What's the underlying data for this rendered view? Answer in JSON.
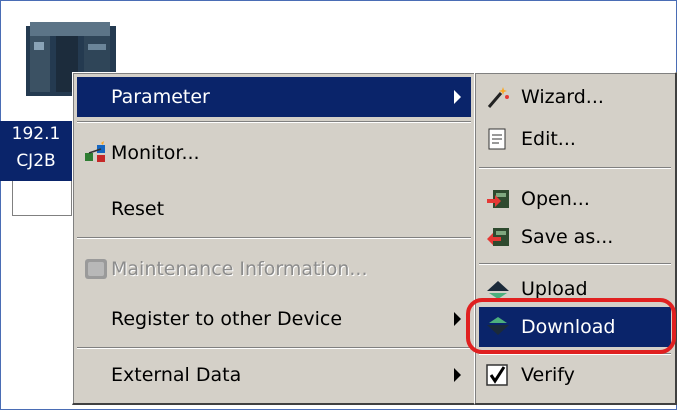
{
  "device": {
    "label_line1": "192.1",
    "label_line2": "CJ2B"
  },
  "context_menu": {
    "items": [
      {
        "label": "Parameter",
        "icon": "none",
        "has_submenu": true,
        "selected": true
      },
      {
        "label": "Monitor...",
        "icon": "monitor-icon",
        "has_submenu": false
      },
      {
        "label": "Reset",
        "icon": "none",
        "has_submenu": false
      },
      {
        "label": "Maintenance Information...",
        "icon": "maintenance-icon",
        "disabled": true
      },
      {
        "label": "Register to other Device",
        "icon": "none",
        "has_submenu": true
      },
      {
        "label": "External Data",
        "icon": "none",
        "has_submenu": true
      }
    ]
  },
  "parameter_submenu": {
    "items": [
      {
        "label": "Wizard...",
        "icon": "wizard-icon"
      },
      {
        "label": "Edit...",
        "icon": "edit-icon"
      },
      {
        "label": "Open...",
        "icon": "open-icon"
      },
      {
        "label": "Save as...",
        "icon": "save-as-icon"
      },
      {
        "label": "Upload",
        "icon": "upload-icon"
      },
      {
        "label": "Download",
        "icon": "download-icon",
        "selected": true,
        "highlighted": true
      },
      {
        "label": "Verify",
        "icon": "verify-icon"
      }
    ]
  },
  "colors": {
    "menu_bg": "#d4d0c8",
    "selection_bg": "#0a246a",
    "highlight_ring": "#e02020"
  }
}
